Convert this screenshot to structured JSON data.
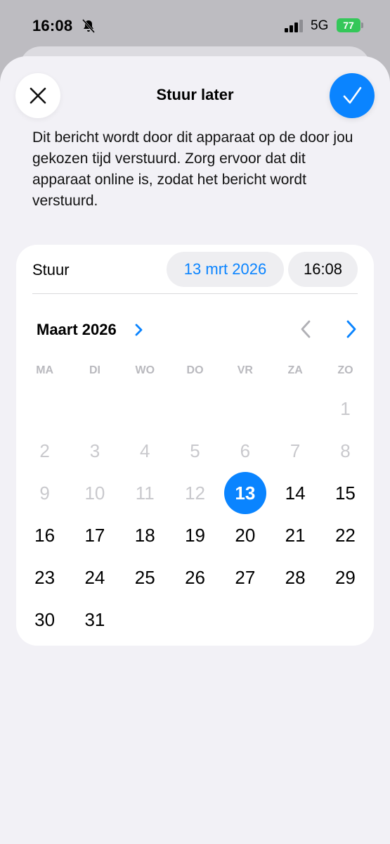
{
  "status_bar": {
    "time": "16:08",
    "network": "5G",
    "battery": "77"
  },
  "sheet": {
    "title": "Stuur later",
    "description": "Dit bericht wordt door dit apparaat op de door jou gekozen tijd verstuurd. Zorg ervoor dat dit apparaat online is, zodat het bericht wordt verstuurd."
  },
  "schedule": {
    "send_label": "Stuur",
    "date_value": "13 mrt 2026",
    "time_value": "16:08"
  },
  "calendar": {
    "month_label": "Maart 2026",
    "weekdays": [
      "MA",
      "DI",
      "WO",
      "DO",
      "VR",
      "ZA",
      "ZO"
    ],
    "leading_blanks": 6,
    "days_in_month": 31,
    "first_selectable_day": 13,
    "selected_day": 13
  },
  "colors": {
    "accent": "#0a84ff",
    "battery": "#34c759",
    "disabled_text": "#c9c9cd"
  },
  "icons": {
    "close": "close-icon",
    "confirm": "checkmark-icon",
    "month_expand": "chevron-right-icon",
    "prev": "chevron-left-icon",
    "next": "chevron-right-icon",
    "silent": "bell-slash-icon",
    "signal": "signal-icon"
  }
}
